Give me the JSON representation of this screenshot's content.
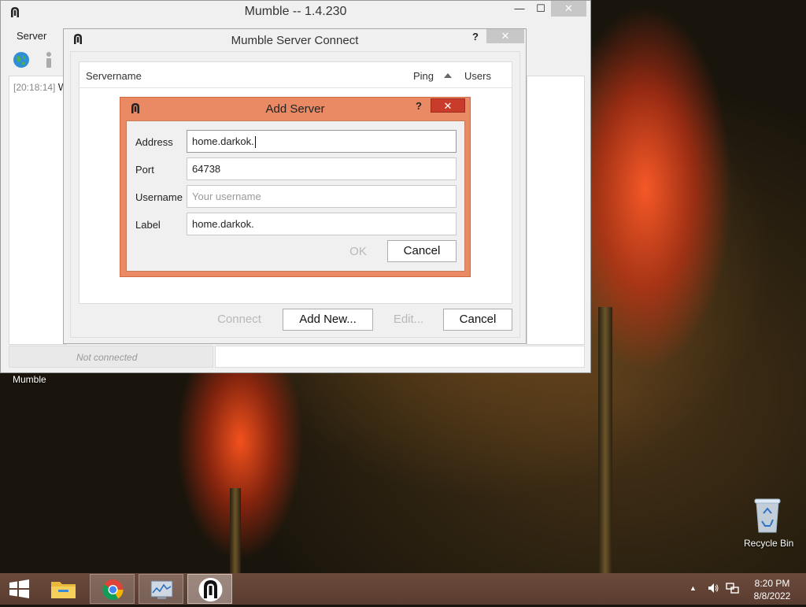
{
  "main_window": {
    "title": "Mumble -- 1.4.230",
    "menu_server": "Server",
    "log_time": "[20:18:14]",
    "log_text": "W",
    "status_text": "Not connected",
    "minimize": "—",
    "maximize": "☐",
    "close": "✕"
  },
  "connect_dialog": {
    "title": "Mumble Server Connect",
    "help": "?",
    "close": "✕",
    "columns": [
      "Servername",
      "Ping",
      "Users"
    ],
    "buttons": {
      "connect": "Connect",
      "add_new": "Add New...",
      "edit": "Edit...",
      "cancel": "Cancel"
    }
  },
  "add_server_dialog": {
    "title": "Add Server",
    "help": "?",
    "close": "✕",
    "fields": {
      "address": {
        "label": "Address",
        "value": "home.darkok."
      },
      "port": {
        "label": "Port",
        "value": "64738"
      },
      "username": {
        "label": "Username",
        "placeholder": "Your username"
      },
      "label": {
        "label": "Label",
        "value": "home.darkok."
      }
    },
    "buttons": {
      "ok": "OK",
      "cancel": "Cancel"
    }
  },
  "desktop": {
    "mumble_label": "Mumble",
    "recycle_bin_label": "Recycle Bin"
  },
  "taskbar": {
    "items": [
      "start-icon",
      "file-explorer-icon",
      "chrome-icon",
      "system-monitor-icon",
      "mumble-icon"
    ],
    "time": "8:20 PM",
    "date": "8/8/2022"
  },
  "colors": {
    "add_server_frame": "#e98a64",
    "add_server_close": "#c93b2b",
    "taskbar": "#5a3c30"
  }
}
